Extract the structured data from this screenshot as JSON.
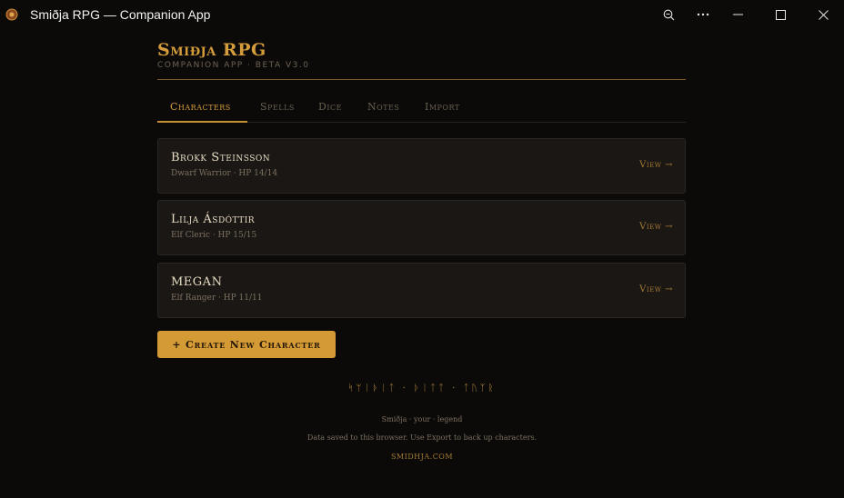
{
  "window": {
    "title": "Smiðja RPG — Companion App",
    "icons": {
      "app": "shield-icon",
      "zoom": "zoom-icon",
      "more": "more-icon",
      "minimize": "minimize-icon",
      "maximize": "maximize-icon",
      "close": "close-icon"
    }
  },
  "header": {
    "brand": "Smiðja RPG",
    "subtitle": "Companion App · Beta v3.0"
  },
  "tabs": [
    {
      "label": "Characters",
      "active": true
    },
    {
      "label": "Spells",
      "active": false
    },
    {
      "label": "Dice",
      "active": false
    },
    {
      "label": "Notes",
      "active": false
    },
    {
      "label": "Import",
      "active": false
    }
  ],
  "characters": [
    {
      "name": "Brokk Steinsson",
      "meta": "Dwarf Warrior · HP 14/14",
      "action": "View →"
    },
    {
      "name": "Lilja Ásdóttir",
      "meta": "Elf Cleric · HP 15/15",
      "action": "View →"
    },
    {
      "name": "MEGAN",
      "meta": "Elf Ranger · HP 11/11",
      "action": "View →"
    }
  ],
  "create_button": "+ Create New Character",
  "footer": {
    "runes": "ᛋᛘᛁᚦᛁᛏ · ᚦᛁᛏᛏ · ᛏᚢᛉᚱ",
    "tagline": "Smiðja · your · legend",
    "note": "Data saved to this browser. Use Export to back up characters.",
    "link": "smidhja.com"
  },
  "colors": {
    "accent": "#d39a35",
    "background": "#0b0a09",
    "card": "#1a1714"
  }
}
